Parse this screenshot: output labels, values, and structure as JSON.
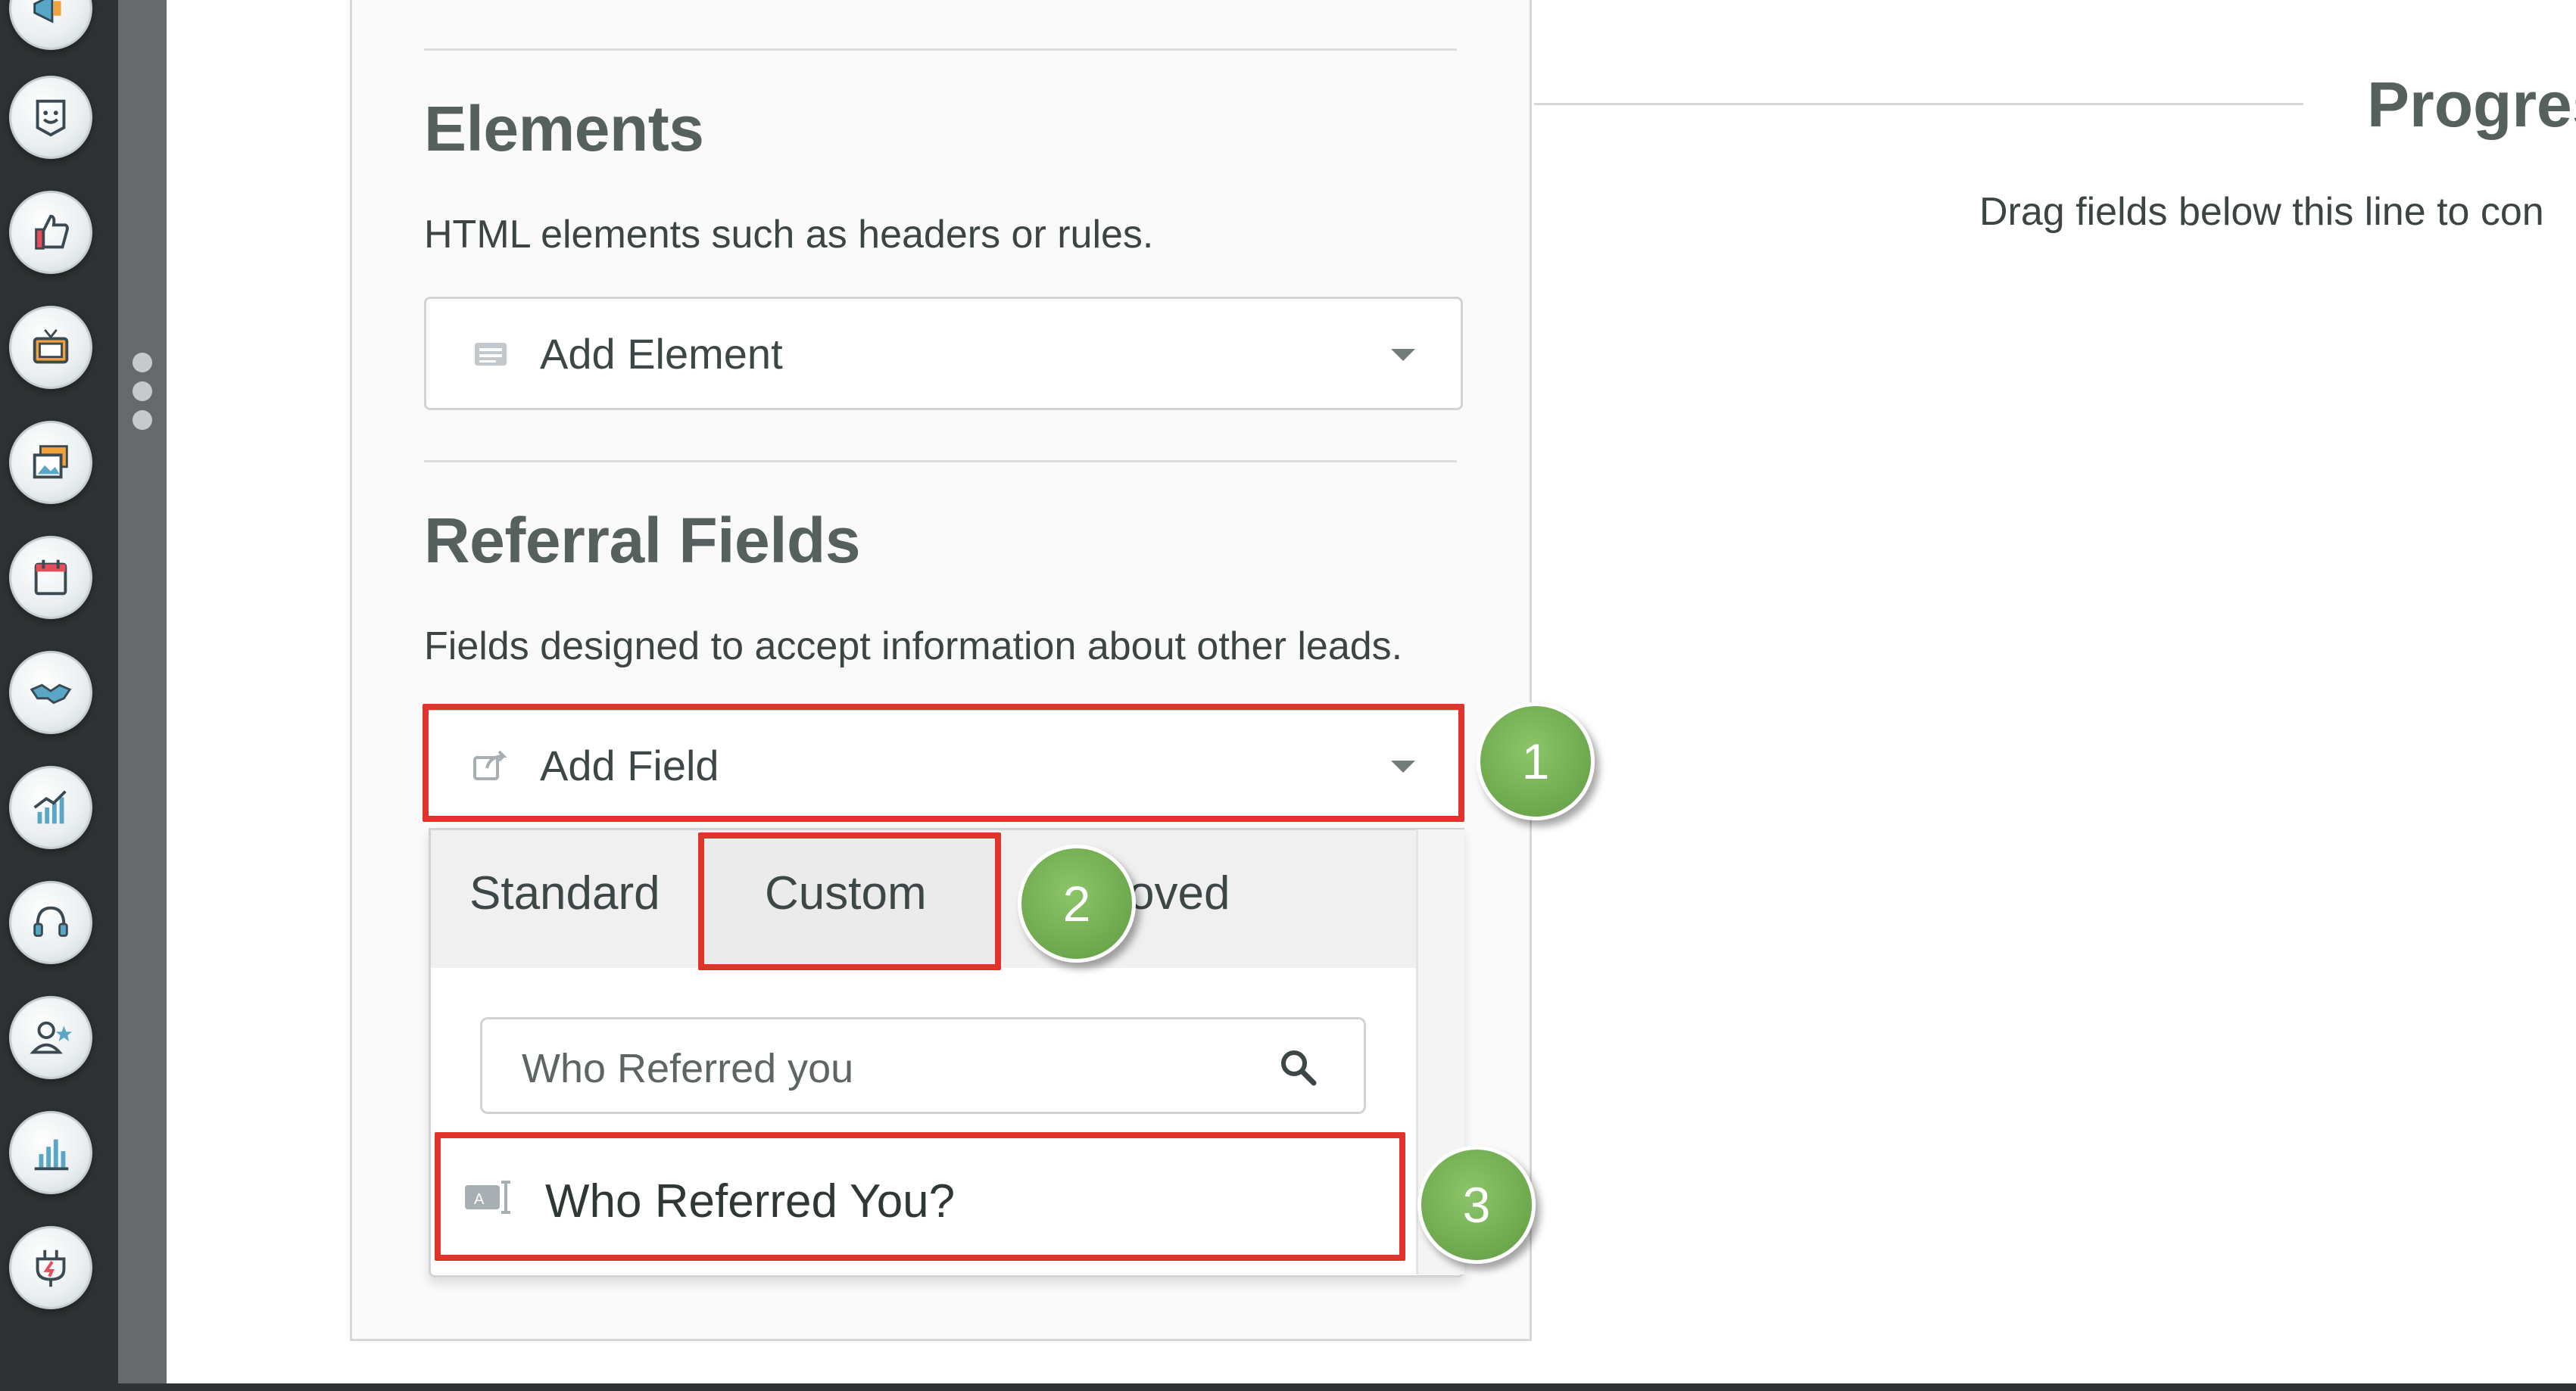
{
  "sidebar": {
    "icons": [
      "megaphone-icon",
      "chat-smile-icon",
      "thumbs-up-icon",
      "tv-icon",
      "gallery-icon",
      "calendar-icon",
      "handshake-icon",
      "chart-growth-icon",
      "headset-icon",
      "user-star-icon",
      "bar-chart-icon",
      "plug-icon"
    ]
  },
  "elements": {
    "title": "Elements",
    "description": "HTML elements such as headers or rules.",
    "select_label": "Add Element"
  },
  "referral": {
    "title": "Referral Fields",
    "description": "Fields designed to accept information about other leads.",
    "select_label": "Add Field"
  },
  "dropdown": {
    "tabs": [
      {
        "label": "Standard"
      },
      {
        "label": "Custom"
      },
      {
        "label": "oved"
      }
    ],
    "search_value": "Who Referred you",
    "result_label": "Who Referred You?"
  },
  "callouts": [
    "1",
    "2",
    "3"
  ],
  "right_panel": {
    "title": "Progres",
    "description": "Drag fields below this line to con"
  },
  "colors": {
    "highlight": "#e0332b",
    "callout": "#6ea84e",
    "rail": "#2f3233"
  }
}
